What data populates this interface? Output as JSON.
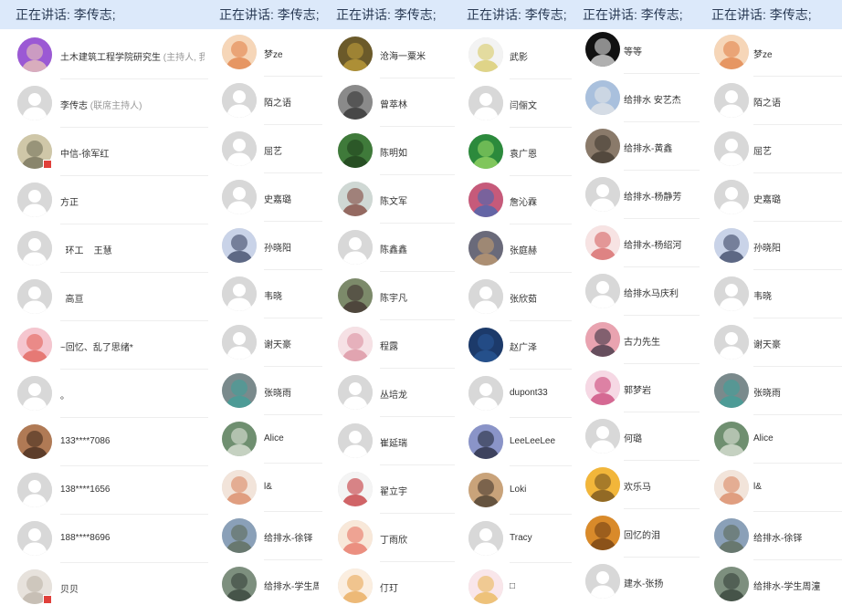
{
  "colors": {
    "header_bg": "#dce9fa",
    "header_text": "#2a3b55",
    "placeholder": "#d8d8d8",
    "badge": "#e0403a"
  },
  "panels": [
    {
      "header": "正在讲话: 李传志;",
      "rows": [
        {
          "name": "土木建筑工程学院研究生",
          "role": "(主持人, 我",
          "avatar": {
            "type": "photo",
            "colors": [
              "#9b59d4",
              "#f3d2b3"
            ]
          }
        },
        {
          "name": "李传志",
          "role": "(联席主持人)",
          "avatar": {
            "type": "placeholder"
          }
        },
        {
          "name": "中信-徐军红",
          "avatar": {
            "type": "photo",
            "colors": [
              "#cfc7a8",
              "#6b6a52"
            ]
          },
          "badge": true
        },
        {
          "name": "方正",
          "avatar": {
            "type": "placeholder"
          }
        },
        {
          "name": "  环工    王慧",
          "avatar": {
            "type": "placeholder"
          }
        },
        {
          "name": "  高亘",
          "avatar": {
            "type": "placeholder"
          }
        },
        {
          "name": "~回忆、乱了思绪*",
          "avatar": {
            "type": "photo",
            "colors": [
              "#f5c6cf",
              "#e0594f"
            ]
          }
        },
        {
          "name": "。",
          "avatar": {
            "type": "placeholder"
          }
        },
        {
          "name": "133****7086",
          "avatar": {
            "type": "photo",
            "colors": [
              "#b07a55",
              "#3a2418"
            ]
          }
        },
        {
          "name": "138****1656",
          "avatar": {
            "type": "placeholder"
          }
        },
        {
          "name": "188****8696",
          "avatar": {
            "type": "placeholder"
          }
        },
        {
          "name": "贝贝",
          "avatar": {
            "type": "photo",
            "colors": [
              "#e7e2dc",
              "#b9b0a4"
            ]
          },
          "badge": true
        }
      ]
    },
    {
      "header": "正在讲话: 李传志;",
      "rows": [
        {
          "name": "梦ze",
          "avatar": {
            "type": "photo",
            "colors": [
              "#f6d6b8",
              "#e07b3f"
            ]
          }
        },
        {
          "name": "陌之语",
          "avatar": {
            "type": "placeholder"
          }
        },
        {
          "name": "屈艺",
          "avatar": {
            "type": "placeholder"
          }
        },
        {
          "name": "史嘉璐",
          "avatar": {
            "type": "placeholder"
          }
        },
        {
          "name": "孙晓阳",
          "avatar": {
            "type": "photo",
            "colors": [
              "#c9d3e8",
              "#2f3a5a"
            ]
          }
        },
        {
          "name": "韦晓",
          "avatar": {
            "type": "placeholder"
          }
        },
        {
          "name": "谢天豪",
          "avatar": {
            "type": "placeholder"
          }
        },
        {
          "name": "张晓雨",
          "avatar": {
            "type": "photo",
            "colors": [
              "#7a8a8c",
              "#3aa39a"
            ]
          }
        },
        {
          "name": "Alice",
          "avatar": {
            "type": "photo",
            "colors": [
              "#6f8f70",
              "#e9ece4"
            ]
          }
        },
        {
          "name": "l&",
          "avatar": {
            "type": "photo",
            "colors": [
              "#f2e4da",
              "#d9805a"
            ]
          }
        },
        {
          "name": "给排水-徐铎",
          "avatar": {
            "type": "photo",
            "colors": [
              "#8aa0b8",
              "#5a6650"
            ]
          }
        },
        {
          "name": "给排水-学生周",
          "avatar": {
            "type": "photo",
            "colors": [
              "#7d8f7e",
              "#2f3b33"
            ]
          }
        }
      ]
    },
    {
      "header": "正在讲话: 李传志;",
      "rows": [
        {
          "name": "沧海一粟米",
          "avatar": {
            "type": "photo",
            "colors": [
              "#6b5a2a",
              "#c9a53c"
            ]
          }
        },
        {
          "name": "曾萃林",
          "avatar": {
            "type": "photo",
            "colors": [
              "#8a8a8a",
              "#2b2b2b"
            ]
          }
        },
        {
          "name": "陈明如",
          "avatar": {
            "type": "photo",
            "colors": [
              "#3f7a3a",
              "#1e3c1a"
            ]
          }
        },
        {
          "name": "陈文军",
          "avatar": {
            "type": "photo",
            "colors": [
              "#cfd8d4",
              "#7a3a30"
            ]
          }
        },
        {
          "name": "陈鑫鑫",
          "avatar": {
            "type": "placeholder"
          }
        },
        {
          "name": "陈宇凡",
          "avatar": {
            "type": "photo",
            "colors": [
              "#7c8a6a",
              "#3a2a2a"
            ]
          }
        },
        {
          "name": "程露",
          "avatar": {
            "type": "photo",
            "colors": [
              "#f6e1e5",
              "#d88a9a"
            ]
          }
        },
        {
          "name": "丛培龙",
          "avatar": {
            "type": "placeholder"
          }
        },
        {
          "name": "崔延瑞",
          "avatar": {
            "type": "placeholder"
          }
        },
        {
          "name": "翟立宇",
          "avatar": {
            "type": "photo",
            "colors": [
              "#f4f4f4",
              "#c0262b"
            ]
          }
        },
        {
          "name": "丁雨欣",
          "avatar": {
            "type": "photo",
            "colors": [
              "#f8e8d9",
              "#e56a5a"
            ]
          }
        },
        {
          "name": "仃玎",
          "avatar": {
            "type": "photo",
            "colors": [
              "#fbeee0",
              "#e7a24a"
            ]
          }
        }
      ]
    },
    {
      "header": "正在讲话: 李传志;",
      "rows": [
        {
          "name": "武影",
          "avatar": {
            "type": "photo",
            "colors": [
              "#f3f3f3",
              "#d6c65a"
            ]
          }
        },
        {
          "name": "闫俪文",
          "avatar": {
            "type": "placeholder"
          }
        },
        {
          "name": "袁广恩",
          "avatar": {
            "type": "photo",
            "colors": [
              "#2c8a3c",
              "#a4e06a"
            ]
          }
        },
        {
          "name": "詹沁霖",
          "avatar": {
            "type": "photo",
            "colors": [
              "#c65a7a",
              "#3a6ab8"
            ]
          }
        },
        {
          "name": "张庭赫",
          "avatar": {
            "type": "photo",
            "colors": [
              "#6a6a7a",
              "#c9a070"
            ]
          }
        },
        {
          "name": "张欣茹",
          "avatar": {
            "type": "placeholder"
          }
        },
        {
          "name": "赵广泽",
          "avatar": {
            "type": "photo",
            "colors": [
              "#1c3a6a",
              "#2a5a9a"
            ]
          }
        },
        {
          "name": "dupont33",
          "avatar": {
            "type": "placeholder"
          }
        },
        {
          "name": "LeeLeeLee",
          "avatar": {
            "type": "photo",
            "colors": [
              "#8a94c8",
              "#1c2030"
            ]
          }
        },
        {
          "name": "Loki",
          "avatar": {
            "type": "photo",
            "colors": [
              "#c9a37a",
              "#3a3026"
            ]
          }
        },
        {
          "name": "Tracy",
          "avatar": {
            "type": "placeholder"
          }
        },
        {
          "name": "□",
          "avatar": {
            "type": "photo",
            "colors": [
              "#f9e6ea",
              "#e9b24a"
            ]
          }
        }
      ]
    },
    {
      "header": "正在讲话: 李传志;",
      "rows": [
        {
          "name": "等等",
          "avatar": {
            "type": "photo",
            "colors": [
              "#111111",
              "#f4f4f4"
            ]
          }
        },
        {
          "name": "给排水 安艺杰",
          "avatar": {
            "type": "photo",
            "colors": [
              "#a9c0dd",
              "#e8e8e8"
            ]
          }
        },
        {
          "name": "给排水-黄鑫",
          "avatar": {
            "type": "photo",
            "colors": [
              "#8a7a6a",
              "#3c342c"
            ]
          }
        },
        {
          "name": "给排水-杨静芳",
          "avatar": {
            "type": "placeholder"
          }
        },
        {
          "name": "给排水-杨绍河",
          "avatar": {
            "type": "photo",
            "colors": [
              "#f7e3e3",
              "#d35a5a"
            ]
          }
        },
        {
          "name": "给排水马庆利",
          "avatar": {
            "type": "placeholder"
          }
        },
        {
          "name": "古力先生",
          "avatar": {
            "type": "photo",
            "colors": [
              "#e9a3b0",
              "#2e2a3a"
            ]
          }
        },
        {
          "name": "郭梦岩",
          "avatar": {
            "type": "photo",
            "colors": [
              "#f6d8e4",
              "#c83a70"
            ]
          }
        },
        {
          "name": "何璐",
          "avatar": {
            "type": "placeholder"
          }
        },
        {
          "name": "欢乐马",
          "avatar": {
            "type": "photo",
            "colors": [
              "#f2b63a",
              "#6a4a1c"
            ]
          }
        },
        {
          "name": "回忆的泪",
          "avatar": {
            "type": "photo",
            "colors": [
              "#d98a2a",
              "#6a3a12"
            ]
          }
        },
        {
          "name": "建水-张扬",
          "avatar": {
            "type": "placeholder"
          }
        }
      ]
    },
    {
      "header": "正在讲话: 李传志;",
      "rows": [
        {
          "name": "梦ze",
          "avatar": {
            "type": "photo",
            "colors": [
              "#f6d6b8",
              "#e07b3f"
            ]
          }
        },
        {
          "name": "陌之语",
          "avatar": {
            "type": "placeholder"
          }
        },
        {
          "name": "屈艺",
          "avatar": {
            "type": "placeholder"
          }
        },
        {
          "name": "史嘉璐",
          "avatar": {
            "type": "placeholder"
          }
        },
        {
          "name": "孙晓阳",
          "avatar": {
            "type": "photo",
            "colors": [
              "#c9d3e8",
              "#2f3a5a"
            ]
          }
        },
        {
          "name": "韦晓",
          "avatar": {
            "type": "placeholder"
          }
        },
        {
          "name": "谢天豪",
          "avatar": {
            "type": "placeholder"
          }
        },
        {
          "name": "张晓雨",
          "avatar": {
            "type": "photo",
            "colors": [
              "#7a8a8c",
              "#3aa39a"
            ]
          }
        },
        {
          "name": "Alice",
          "avatar": {
            "type": "photo",
            "colors": [
              "#6f8f70",
              "#e9ece4"
            ]
          }
        },
        {
          "name": "l&",
          "avatar": {
            "type": "photo",
            "colors": [
              "#f2e4da",
              "#d9805a"
            ]
          }
        },
        {
          "name": "给排水-徐铎",
          "avatar": {
            "type": "photo",
            "colors": [
              "#8aa0b8",
              "#5a6650"
            ]
          }
        },
        {
          "name": "给排水-学生周潼",
          "avatar": {
            "type": "photo",
            "colors": [
              "#7d8f7e",
              "#2f3b33"
            ]
          }
        }
      ]
    }
  ]
}
